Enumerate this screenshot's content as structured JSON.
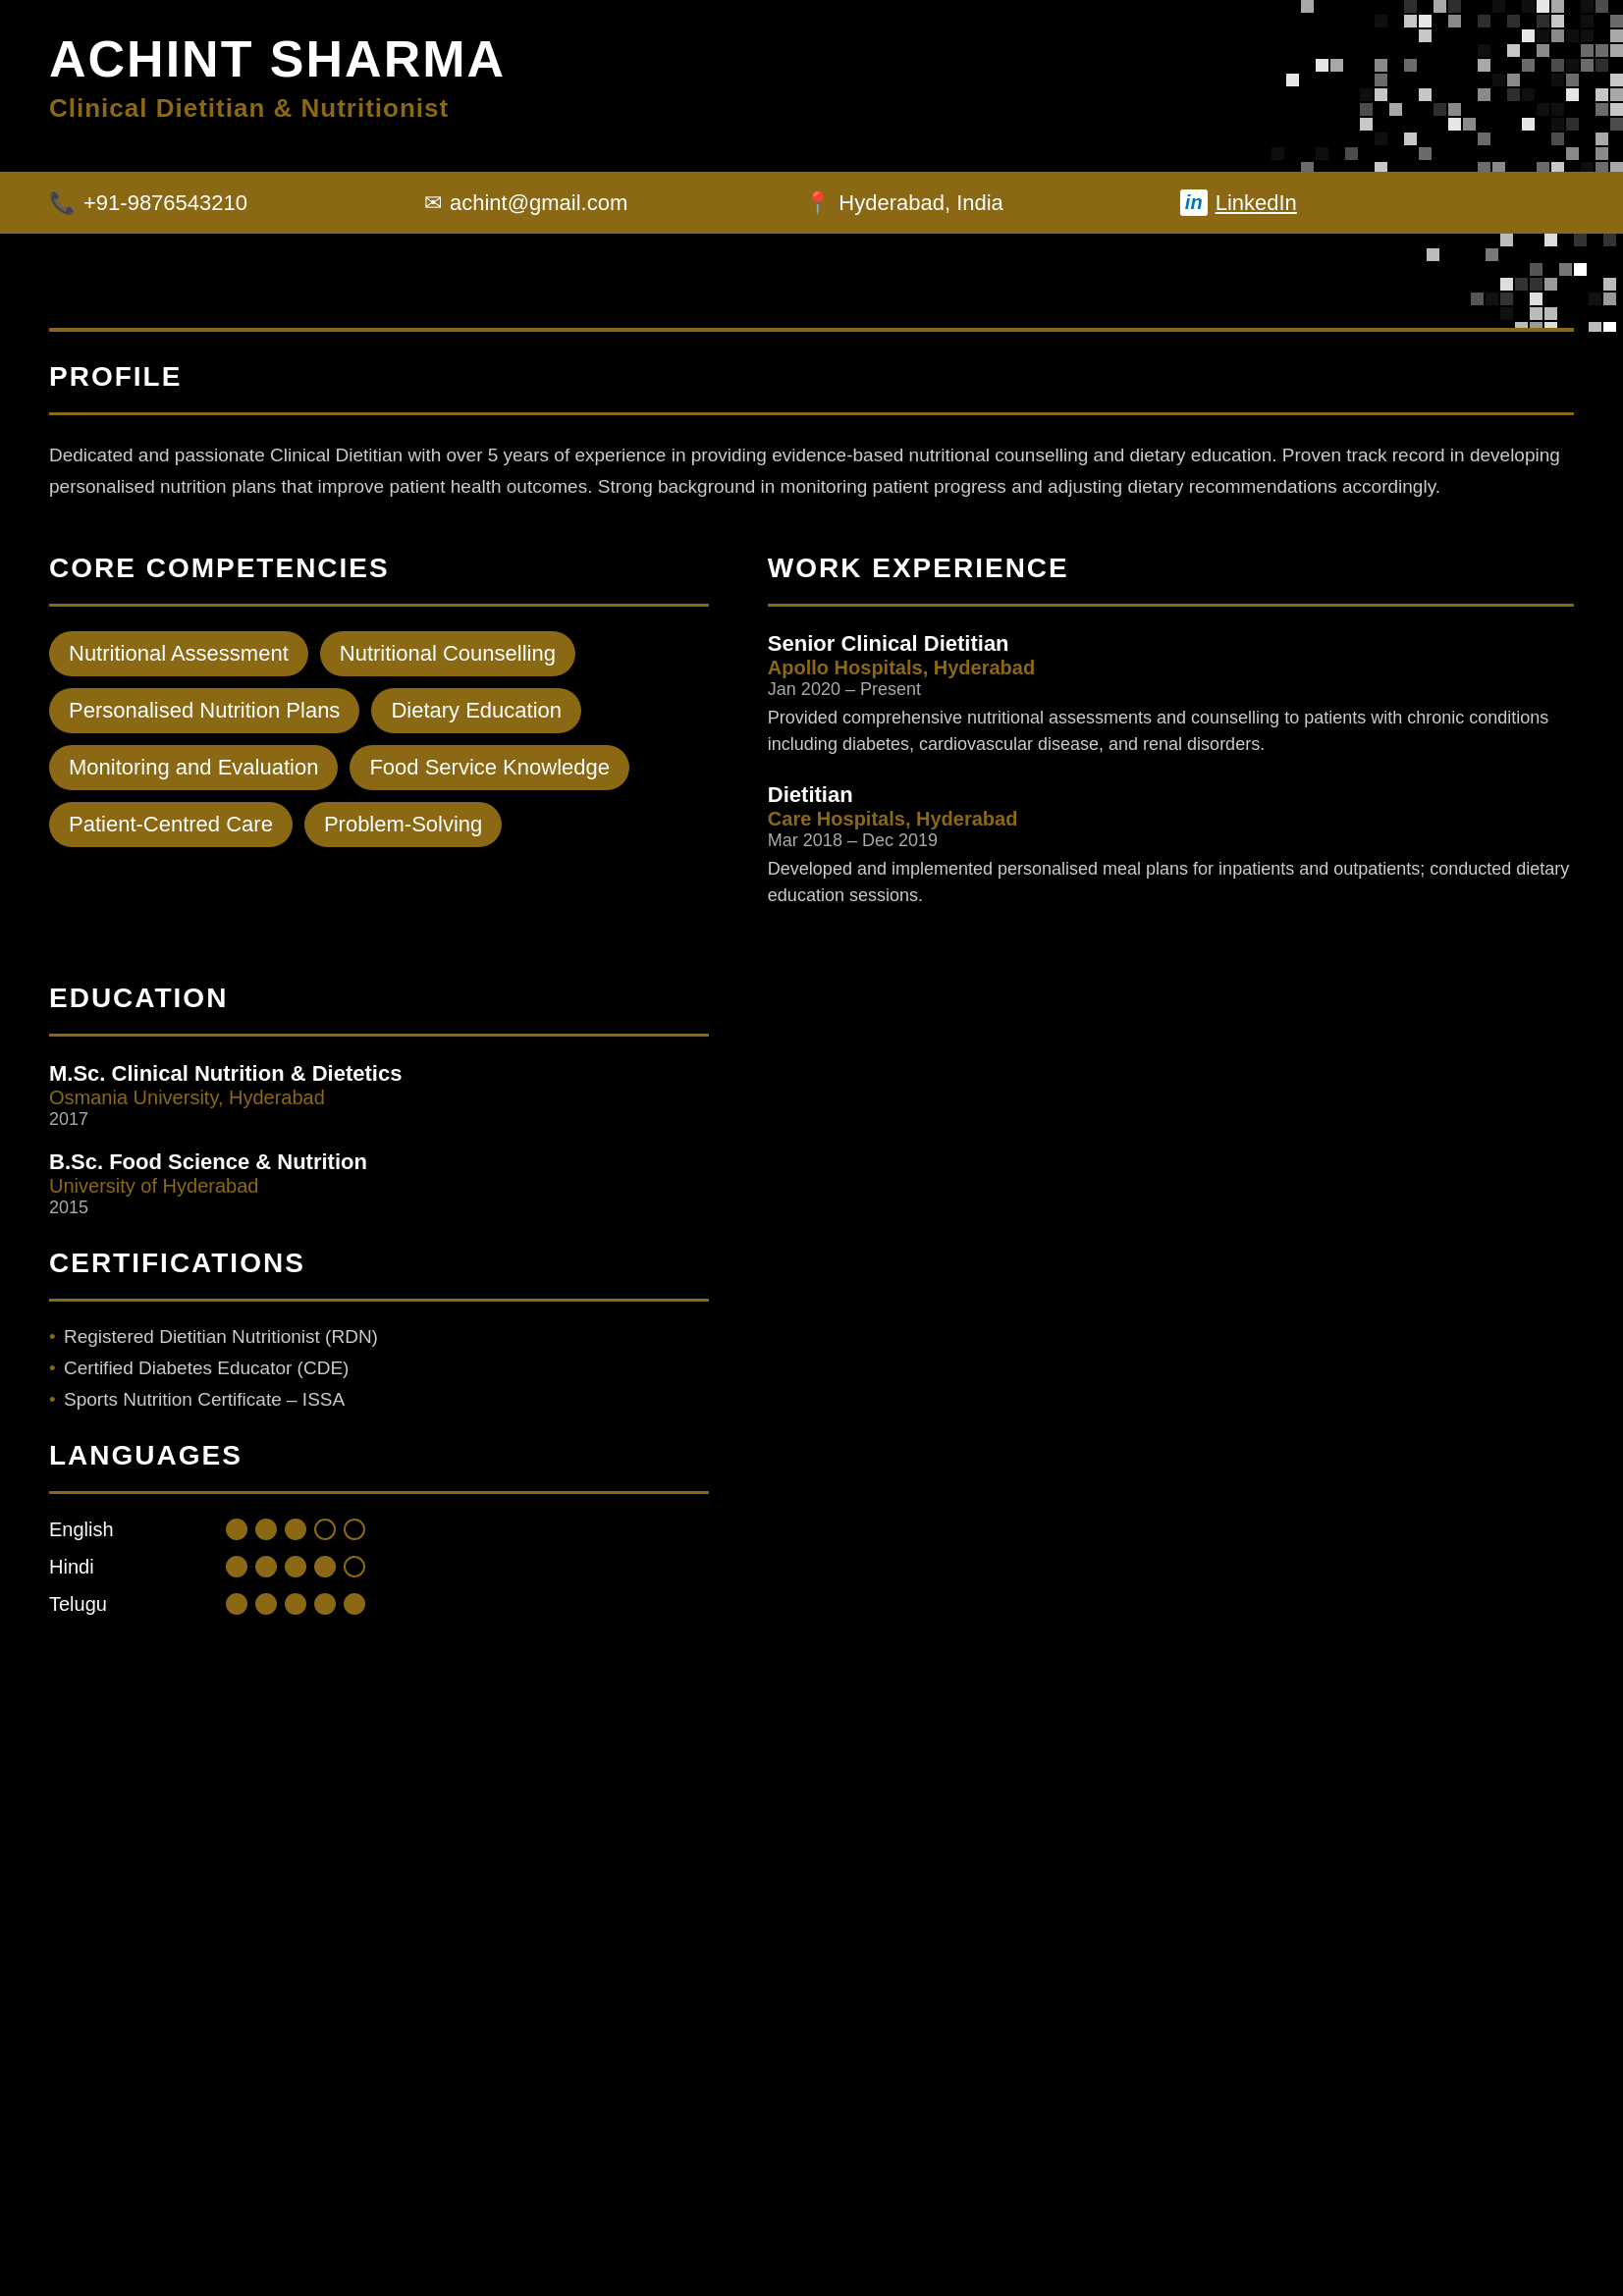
{
  "header": {
    "pixel_decoration": "top-right mosaic pattern in grays and whites"
  },
  "contact_bar": {
    "phone_icon": "📞",
    "phone": "+91-9876543210",
    "email_icon": "✉",
    "email": "achint@gmail.com",
    "location_icon": "📍",
    "location": "Hyderabad, India",
    "linkedin_icon": "in",
    "linkedin_label": "LinkedIn",
    "linkedin_url": "#"
  },
  "person": {
    "name": "ACHINT SHARMA",
    "title": "Clinical Dietitian & Nutritionist"
  },
  "sections": {
    "skills": {
      "header": "CORE COMPETENCIES",
      "items": [
        "Nutritional Assessment",
        "Nutritional Counselling",
        "Personalised Nutrition Plans",
        "Dietary Education",
        "Monitoring and Evaluation",
        "Food Service Knowledge",
        "Patient-Centred Care",
        "Problem-Solving"
      ]
    },
    "profile": {
      "header": "PROFILE",
      "text": "Dedicated and passionate Clinical Dietitian with over 5 years of experience in providing evidence-based nutritional counselling and dietary education. Proven track record in developing personalised nutrition plans that improve patient health outcomes. Strong background in monitoring patient progress and adjusting dietary recommendations accordingly."
    },
    "experience": {
      "header": "WORK EXPERIENCE",
      "items": [
        {
          "role": "Senior Clinical Dietitian",
          "org": "Apollo Hospitals, Hyderabad",
          "dates": "Jan 2020 – Present",
          "desc": "Provided comprehensive nutritional assessments and counselling to patients with chronic conditions including diabetes, cardiovascular disease, and renal disorders."
        },
        {
          "role": "Dietitian",
          "org": "Care Hospitals, Hyderabad",
          "dates": "Mar 2018 – Dec 2019",
          "desc": "Developed and implemented personalised meal plans for inpatients and outpatients; conducted dietary education sessions."
        }
      ]
    },
    "education": {
      "header": "EDUCATION",
      "items": [
        {
          "degree": "M.Sc. Clinical Nutrition & Dietetics",
          "school": "Osmania University, Hyderabad",
          "year": "2017"
        },
        {
          "degree": "B.Sc. Food Science & Nutrition",
          "school": "University of Hyderabad",
          "year": "2015"
        }
      ]
    },
    "certifications": {
      "header": "CERTIFICATIONS",
      "items": [
        "Registered Dietitian Nutritionist (RDN)",
        "Certified Diabetes Educator (CDE)",
        "Sports Nutrition Certificate – ISSA"
      ]
    },
    "languages": {
      "header": "LANGUAGES",
      "items": [
        {
          "name": "English",
          "filled": 3,
          "empty": 2
        },
        {
          "name": "Hindi",
          "filled": 4,
          "empty": 1
        },
        {
          "name": "Telugu",
          "filled": 5,
          "empty": 0
        }
      ]
    }
  },
  "colors": {
    "gold": "#8B6914",
    "black": "#000000",
    "white": "#ffffff"
  }
}
